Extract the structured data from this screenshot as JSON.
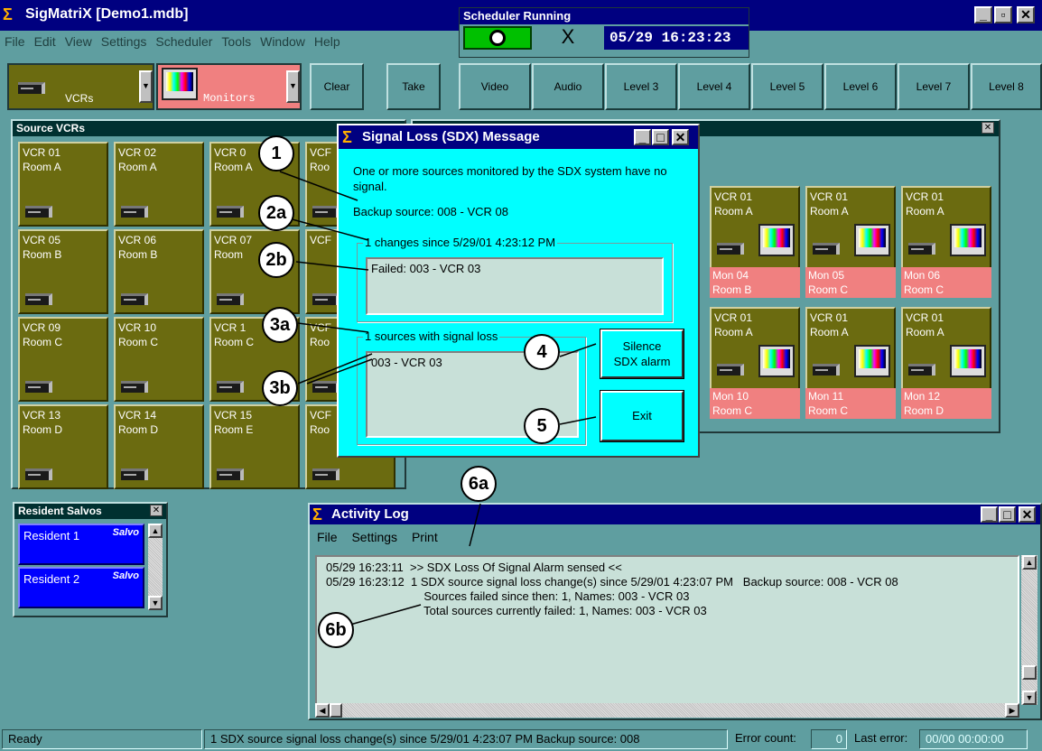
{
  "app": {
    "title": "SigMatriX  [Demo1.mdb]",
    "logo": "sigma-icon"
  },
  "scheduler": {
    "title": "Scheduler Running",
    "datetime": "05/29  16:23:23",
    "stop_glyph": "X"
  },
  "menu": [
    "File",
    "Edit",
    "View",
    "Settings",
    "Scheduler",
    "Tools",
    "Window",
    "Help"
  ],
  "toolbar": {
    "sources_combo": "VCRs",
    "dest_combo": "Monitors",
    "clear": "Clear",
    "take": "Take",
    "levels": [
      "Video",
      "Audio",
      "Level 3",
      "Level 4",
      "Level 5",
      "Level 6",
      "Level 7",
      "Level 8"
    ]
  },
  "source_panel": {
    "title": "Source VCRs",
    "tiles": [
      {
        "name": "VCR 01",
        "room": "Room A"
      },
      {
        "name": "VCR 02",
        "room": "Room A"
      },
      {
        "name": "VCR 0",
        "room": "Room A"
      },
      {
        "name": "VCF",
        "room": "Roo"
      },
      {
        "name": "VCR 05",
        "room": "Room B"
      },
      {
        "name": "VCR 06",
        "room": "Room B"
      },
      {
        "name": "VCR 07",
        "room": "Room"
      },
      {
        "name": "VCF",
        "room": ""
      },
      {
        "name": "VCR 09",
        "room": "Room C"
      },
      {
        "name": "VCR 10",
        "room": "Room C"
      },
      {
        "name": "VCR 1",
        "room": "Room C"
      },
      {
        "name": "VCF",
        "room": "Roo"
      },
      {
        "name": "VCR 13",
        "room": "Room D"
      },
      {
        "name": "VCR 14",
        "room": "Room D"
      },
      {
        "name": "VCR 15",
        "room": "Room E"
      },
      {
        "name": "VCF",
        "room": "Roo"
      }
    ]
  },
  "monitor_tiles": [
    {
      "src": "VCR 01",
      "room": "Room A",
      "mon": "Mon 04",
      "mroom": "Room B"
    },
    {
      "src": "VCR 01",
      "room": "Room A",
      "mon": "Mon 05",
      "mroom": "Room C"
    },
    {
      "src": "VCR 01",
      "room": "Room A",
      "mon": "Mon 06",
      "mroom": "Room C"
    },
    {
      "src": "VCR 01",
      "room": "Room A",
      "mon": "Mon 10",
      "mroom": "Room C"
    },
    {
      "src": "VCR 01",
      "room": "Room A",
      "mon": "Mon 11",
      "mroom": "Room C"
    },
    {
      "src": "VCR 01",
      "room": "Room A",
      "mon": "Mon 12",
      "mroom": "Room D"
    }
  ],
  "dialog": {
    "title": "Signal Loss (SDX) Message",
    "message": "One or more sources monitored by the SDX system have no signal.",
    "backup": "Backup source: 008 - VCR 08",
    "changes_label": "1 changes since 5/29/01 4:23:12 PM",
    "changes_item": "Failed: 003 - VCR 03",
    "loss_label": "1 sources with signal loss",
    "loss_item": "003 - VCR 03",
    "silence_line1": "Silence",
    "silence_line2": "SDX alarm",
    "exit": "Exit"
  },
  "callouts": [
    "1",
    "2a",
    "2b",
    "3a",
    "3b",
    "4",
    "5",
    "6a",
    "6b"
  ],
  "salvos": {
    "title": "Resident Salvos",
    "items": [
      "Resident 1",
      "Resident 2"
    ],
    "badge": "Salvo"
  },
  "activity_log": {
    "title": "Activity Log",
    "menu": [
      "File",
      "Settings",
      "Print"
    ],
    "lines": [
      "05/29 16:23:11  >> SDX Loss Of Signal Alarm sensed <<",
      "05/29 16:23:12  1 SDX source signal loss change(s) since 5/29/01 4:23:07 PM   Backup source: 008 - VCR 08",
      "                              Sources failed since then: 1, Names: 003 - VCR 03",
      "                              Total sources currently failed: 1, Names: 003 - VCR 03"
    ]
  },
  "statusbar": {
    "ready": "Ready",
    "message": "1 SDX source signal loss change(s) since 5/29/01 4:23:07 PM   Backup source: 008",
    "error_label": "Error count:",
    "error_count": "0",
    "last_error_label": "Last error:",
    "last_error": "00/00  00:00:00"
  }
}
